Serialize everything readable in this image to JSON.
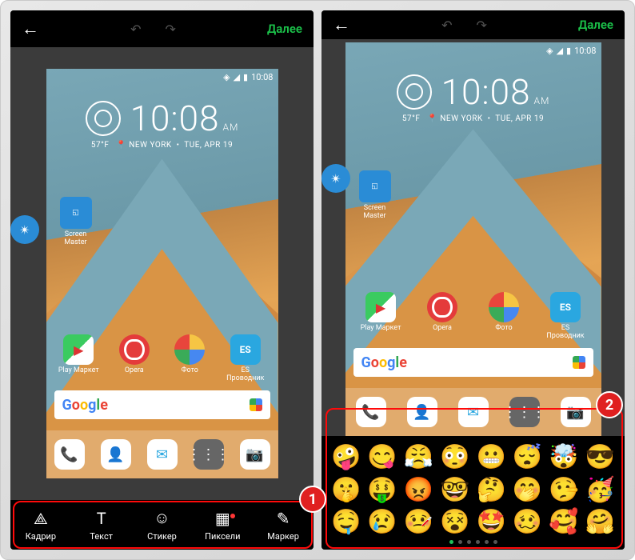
{
  "topbar": {
    "next_label": "Далее"
  },
  "status": {
    "time": "10:08"
  },
  "clock": {
    "time": "10:08",
    "ampm": "AM"
  },
  "weather": {
    "temp": "57°F",
    "city": "NEW YORK",
    "date": "TUE, APR 19"
  },
  "widget": {
    "screen_master": "Screen Master"
  },
  "apps": {
    "play": "Play Маркет",
    "opera": "Opera",
    "photo": "Фото",
    "es": "ES Проводник"
  },
  "tools": {
    "crop": "Кадрир",
    "text": "Текст",
    "sticker": "Стикер",
    "pixels": "Пиксели",
    "marker": "Маркер"
  },
  "emoji": [
    "🤪",
    "😋",
    "😤",
    "😳",
    "😬",
    "😴",
    "🤯",
    "😎",
    "🤫",
    "🤑",
    "😡",
    "🤓",
    "🤔",
    "🤭",
    "🤥",
    "🥳",
    "🤤",
    "😢",
    "🤒",
    "😵",
    "🤩",
    "🥴",
    "🥰",
    "🤗"
  ],
  "callouts": {
    "one": "1",
    "two": "2"
  }
}
